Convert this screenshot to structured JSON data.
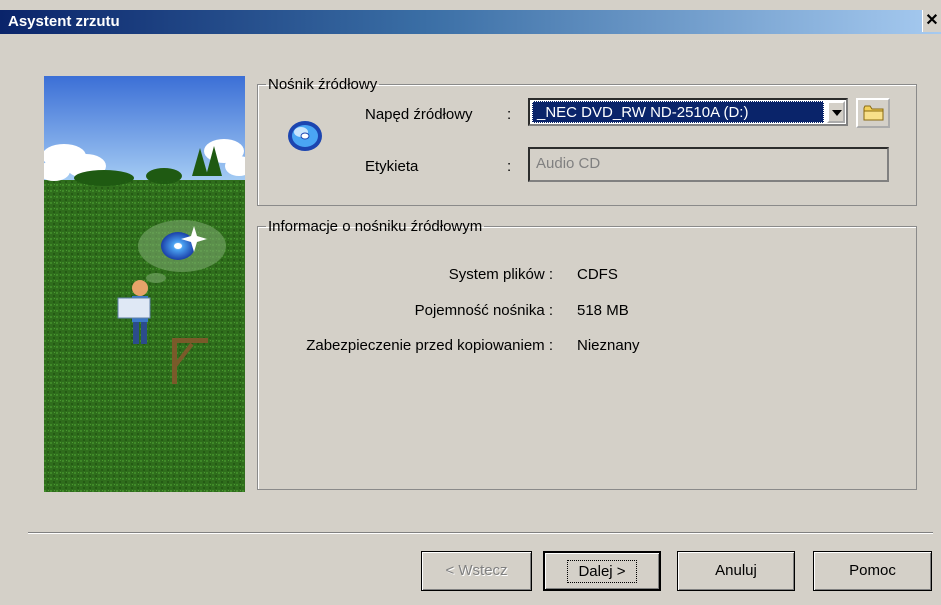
{
  "window": {
    "title": "Asystent zrzutu",
    "close_glyph": "✕"
  },
  "source_group": {
    "legend": "Nośnik źródłowy",
    "drive_label": "Napęd źródłowy",
    "drive_sep": ":",
    "drive_value": "_NEC DVD_RW ND-2510A (D:)",
    "label_label": "Etykieta",
    "label_sep": ":",
    "label_value": "Audio CD"
  },
  "info_group": {
    "legend": "Informacje o nośniku źródłowym",
    "rows": [
      {
        "label": "System plików :",
        "value": "CDFS"
      },
      {
        "label": "Pojemność nośnika :",
        "value": "518 MB"
      },
      {
        "label": "Zabezpieczenie przed kopiowaniem :",
        "value": "Nieznany"
      }
    ]
  },
  "buttons": {
    "back": "< Wstecz",
    "next": "Dalej >",
    "cancel": "Anuluj",
    "help": "Pomoc"
  },
  "icons": [
    "cd-icon",
    "folder-icon",
    "wizard-illustration"
  ]
}
